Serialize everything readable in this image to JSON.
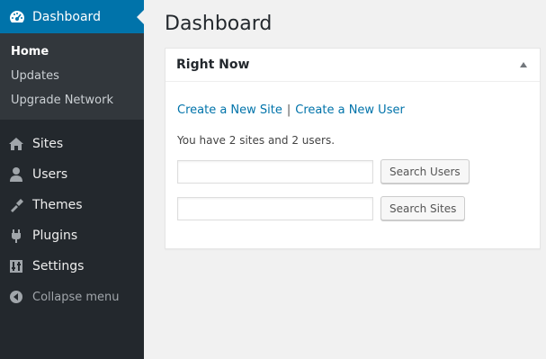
{
  "sidebar": {
    "active": {
      "label": "Dashboard",
      "icon": "dashboard-icon"
    },
    "submenu": [
      {
        "label": "Home",
        "current": true
      },
      {
        "label": "Updates",
        "current": false
      },
      {
        "label": "Upgrade Network",
        "current": false
      }
    ],
    "items": [
      {
        "label": "Sites",
        "icon": "sites-icon"
      },
      {
        "label": "Users",
        "icon": "users-icon"
      },
      {
        "label": "Themes",
        "icon": "themes-icon"
      },
      {
        "label": "Plugins",
        "icon": "plugins-icon"
      },
      {
        "label": "Settings",
        "icon": "settings-icon"
      }
    ],
    "collapse_label": "Collapse menu"
  },
  "main": {
    "title": "Dashboard",
    "widget": {
      "title": "Right Now",
      "link_new_site": "Create a New Site",
      "separator": "|",
      "link_new_user": "Create a New User",
      "summary": "You have 2 sites and 2 users.",
      "search_users": {
        "value": "",
        "button": "Search Users"
      },
      "search_sites": {
        "value": "",
        "button": "Search Sites"
      }
    }
  },
  "colors": {
    "sidebar_bg": "#23282d",
    "submenu_bg": "#32373c",
    "accent": "#0073aa",
    "page_bg": "#f1f1f1"
  }
}
